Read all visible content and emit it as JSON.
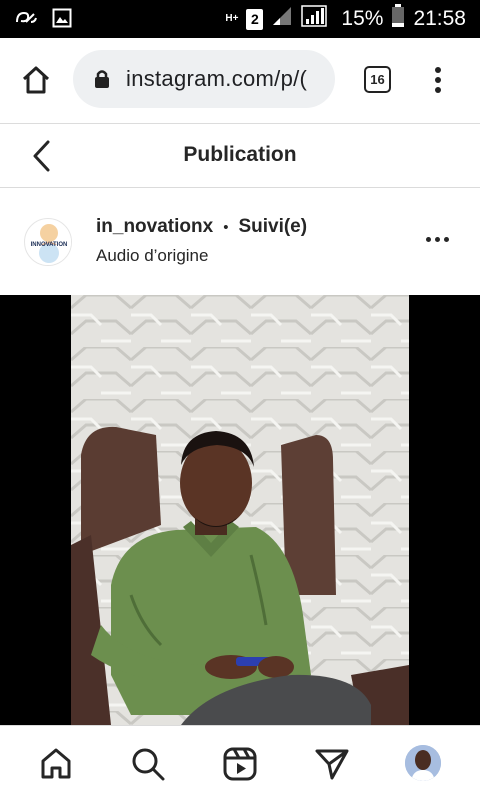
{
  "status_bar": {
    "network_type": "H+",
    "sim_slot": "2",
    "battery": "15%",
    "time": "21:58"
  },
  "browser": {
    "url": "instagram.com/p/(",
    "tab_count": "16"
  },
  "page": {
    "title": "Publication"
  },
  "post": {
    "username": "in_novationx",
    "separator": "•",
    "follow_status": "Suivi(e)",
    "audio": "Audio d’origine",
    "avatar_logo_text": "INNOVATION"
  },
  "icons": {
    "status_left": [
      "app-icon",
      "image-icon"
    ],
    "bottom_nav": [
      "home-icon",
      "search-icon",
      "reels-icon",
      "send-icon",
      "profile-avatar"
    ]
  }
}
